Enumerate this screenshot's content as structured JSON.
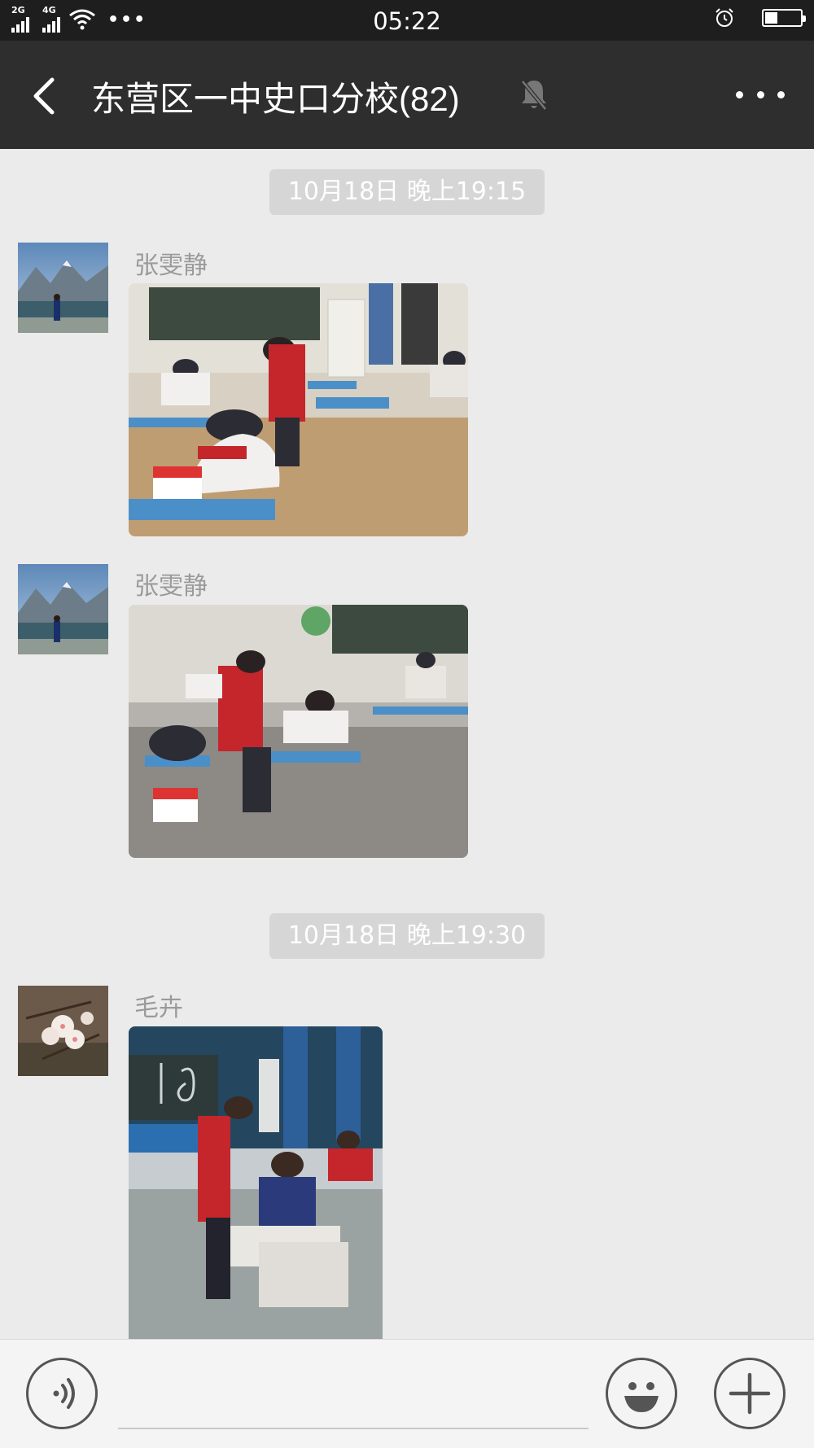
{
  "status_bar": {
    "signal_1_label": "2G",
    "signal_2_label": "4G",
    "overflow_dots": "•••",
    "time": "05:22",
    "battery_level": 0.35
  },
  "header": {
    "title": "东营区一中史口分校(82)",
    "muted": true
  },
  "messages": [
    {
      "type": "timestamp",
      "text": "10月18日 晚上19:15"
    },
    {
      "type": "image",
      "sender": "张雯静",
      "avatar": "mountain-lake-photo",
      "image": "classroom-photo-1"
    },
    {
      "type": "image",
      "sender": "张雯静",
      "avatar": "mountain-lake-photo",
      "image": "classroom-photo-2"
    },
    {
      "type": "timestamp",
      "text": "10月18日 晚上19:30"
    },
    {
      "type": "image",
      "sender": "毛卉",
      "avatar": "blossom-photo",
      "image": "classroom-photo-3"
    }
  ],
  "input_bar": {
    "voice_button": "voice-icon",
    "emoji_button": "emoji-icon",
    "plus_button": "plus-icon"
  },
  "colors": {
    "title_bar": "#2e2e2e",
    "status_bar": "#1e1e1e",
    "chat_background": "#ebebeb",
    "timestamp_pill": "#d6d6d6"
  }
}
